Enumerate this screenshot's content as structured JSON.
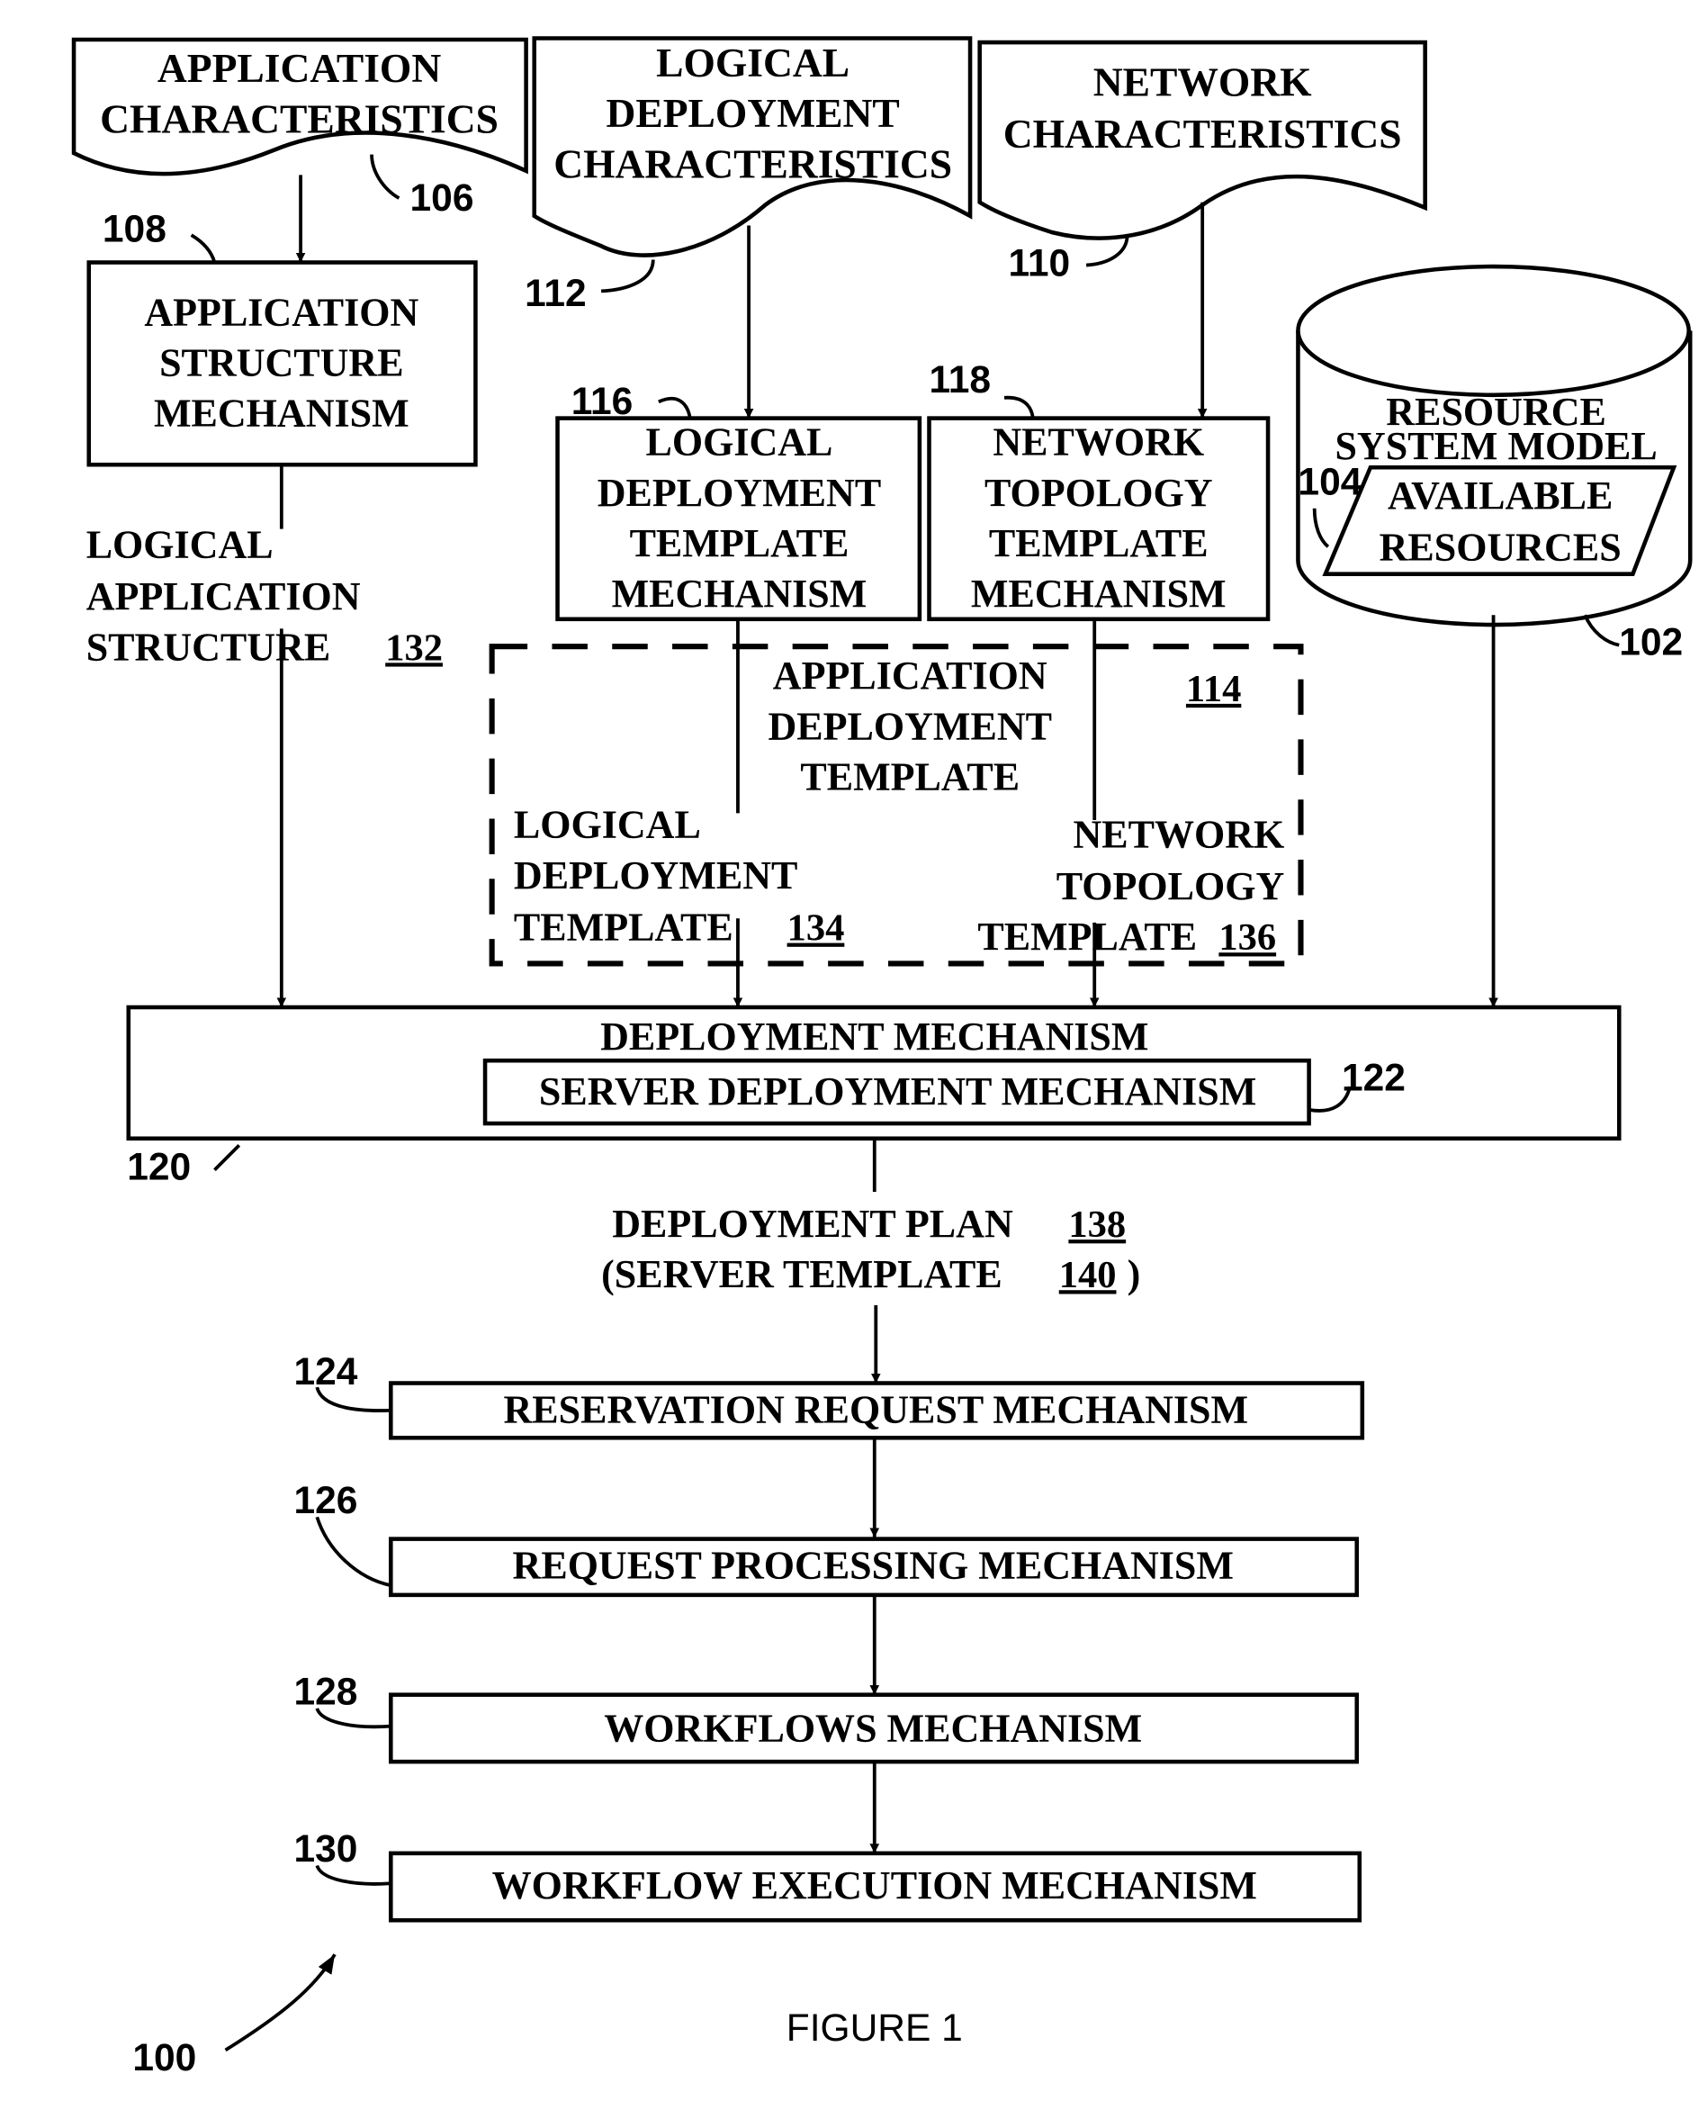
{
  "figure": {
    "caption": "FIGURE 1",
    "ref": "100"
  },
  "inputs": {
    "application_characteristics": {
      "lines": [
        "APPLICATION",
        "CHARACTERISTICS"
      ],
      "ref": "106"
    },
    "logical_deployment_characteristics": {
      "lines": [
        "LOGICAL",
        "DEPLOYMENT",
        "CHARACTERISTICS"
      ],
      "ref": "112"
    },
    "network_characteristics": {
      "lines": [
        "NETWORK",
        "CHARACTERISTICS"
      ],
      "ref": "110"
    }
  },
  "mechanisms": {
    "application_structure": {
      "lines": [
        "APPLICATION",
        "STRUCTURE",
        "MECHANISM"
      ],
      "ref": "108"
    },
    "logical_deployment_template": {
      "lines": [
        "LOGICAL",
        "DEPLOYMENT",
        "TEMPLATE",
        "MECHANISM"
      ],
      "ref": "116"
    },
    "network_topology_template": {
      "lines": [
        "NETWORK",
        "TOPOLOGY",
        "TEMPLATE",
        "MECHANISM"
      ],
      "ref": "118"
    },
    "deployment": {
      "label": "DEPLOYMENT MECHANISM",
      "ref": "120"
    },
    "server_deployment": {
      "label": "SERVER DEPLOYMENT MECHANISM",
      "ref": "122"
    },
    "reservation_request": {
      "label": "RESERVATION REQUEST MECHANISM",
      "ref": "124"
    },
    "request_processing": {
      "label": "REQUEST PROCESSING MECHANISM",
      "ref": "126"
    },
    "workflows": {
      "label": "WORKFLOWS MECHANISM",
      "ref": "128"
    },
    "workflow_execution": {
      "label": "WORKFLOW EXECUTION MECHANISM",
      "ref": "130"
    }
  },
  "resource_system_model": {
    "lines": [
      "RESOURCE",
      "SYSTEM MODEL"
    ],
    "ref": "102",
    "available_resources": {
      "lines": [
        "AVAILABLE",
        "RESOURCES"
      ],
      "ref": "104"
    }
  },
  "logical_application_structure": {
    "lines": [
      "LOGICAL",
      "APPLICATION",
      "STRUCTURE"
    ],
    "ref": "132"
  },
  "application_deployment_template": {
    "lines": [
      "APPLICATION",
      "DEPLOYMENT",
      "TEMPLATE"
    ],
    "ref": "114",
    "logical_deployment_template": {
      "lines": [
        "LOGICAL",
        "DEPLOYMENT",
        "TEMPLATE"
      ],
      "ref": "134"
    },
    "network_topology_template": {
      "lines": [
        "NETWORK",
        "TOPOLOGY",
        "TEMPLATE"
      ],
      "ref": "136"
    }
  },
  "deployment_plan": {
    "line1": "DEPLOYMENT PLAN",
    "ref1": "138",
    "line2_prefix": "(SERVER TEMPLATE",
    "ref2": "140",
    "line2_suffix": ")"
  }
}
